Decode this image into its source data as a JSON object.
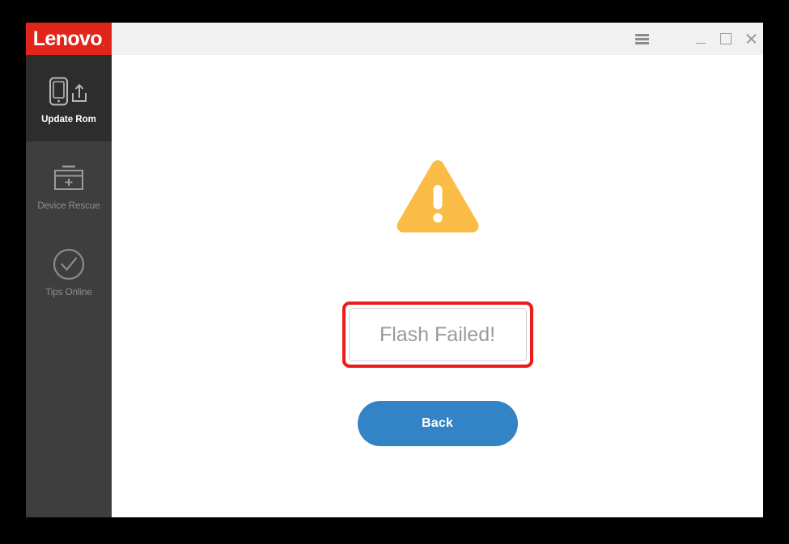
{
  "window": {
    "brand": "Lenovo",
    "brand_trademark": ".",
    "brand_color": "#e1251b"
  },
  "titlebar": {
    "menu_label": "menu",
    "minimize_label": "Minimize",
    "maximize_label": "Maximize",
    "close_label": "Close"
  },
  "sidebar": {
    "items": [
      {
        "label": "Update Rom",
        "icon": "phone-upload-icon",
        "active": true
      },
      {
        "label": "Device Rescue",
        "icon": "toolbox-plus-icon",
        "active": false
      },
      {
        "label": "Tips Online",
        "icon": "check-circle-icon",
        "active": false
      }
    ]
  },
  "main": {
    "status_icon": "warning-triangle-icon",
    "status_icon_color": "#fbbc46",
    "message": "Flash Failed!",
    "message_color": "#9a9a9a",
    "back_label": "Back",
    "back_color": "#3384c6",
    "annotation_color": "#ee1b1b"
  }
}
